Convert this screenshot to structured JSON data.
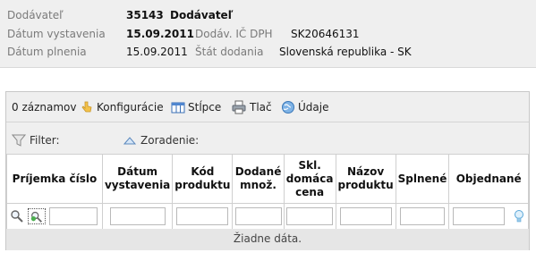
{
  "info": {
    "supplier_label": "Dodávateľ",
    "supplier_code": "35143",
    "supplier_name": "Dodávateľ",
    "issue_date_label": "Dátum vystavenia",
    "issue_date": "15.09.2011",
    "vat_label": "Dodáv. IČ DPH",
    "vat_value": "SK20646131",
    "fulfil_date_label": "Dátum plnenia",
    "fulfil_date": "15.09.2011",
    "country_label": "Štát dodania",
    "country_value": "Slovenská republika - SK"
  },
  "toolbar": {
    "records": "0 záznamov",
    "config": "Konfigurácie",
    "columns": "Stĺpce",
    "print": "Tlač",
    "data": "Údaje"
  },
  "filterbar": {
    "filter": "Filter:",
    "sort": "Zoradenie:"
  },
  "grid": {
    "columns": [
      "Príjemka číslo",
      "Dátum vystavenia",
      "Kód produktu",
      "Dodané množ.",
      "Skl. domáca cena",
      "Názov produktu",
      "Splnené",
      "Objednané"
    ],
    "empty_text": "Žiadne dáta."
  }
}
